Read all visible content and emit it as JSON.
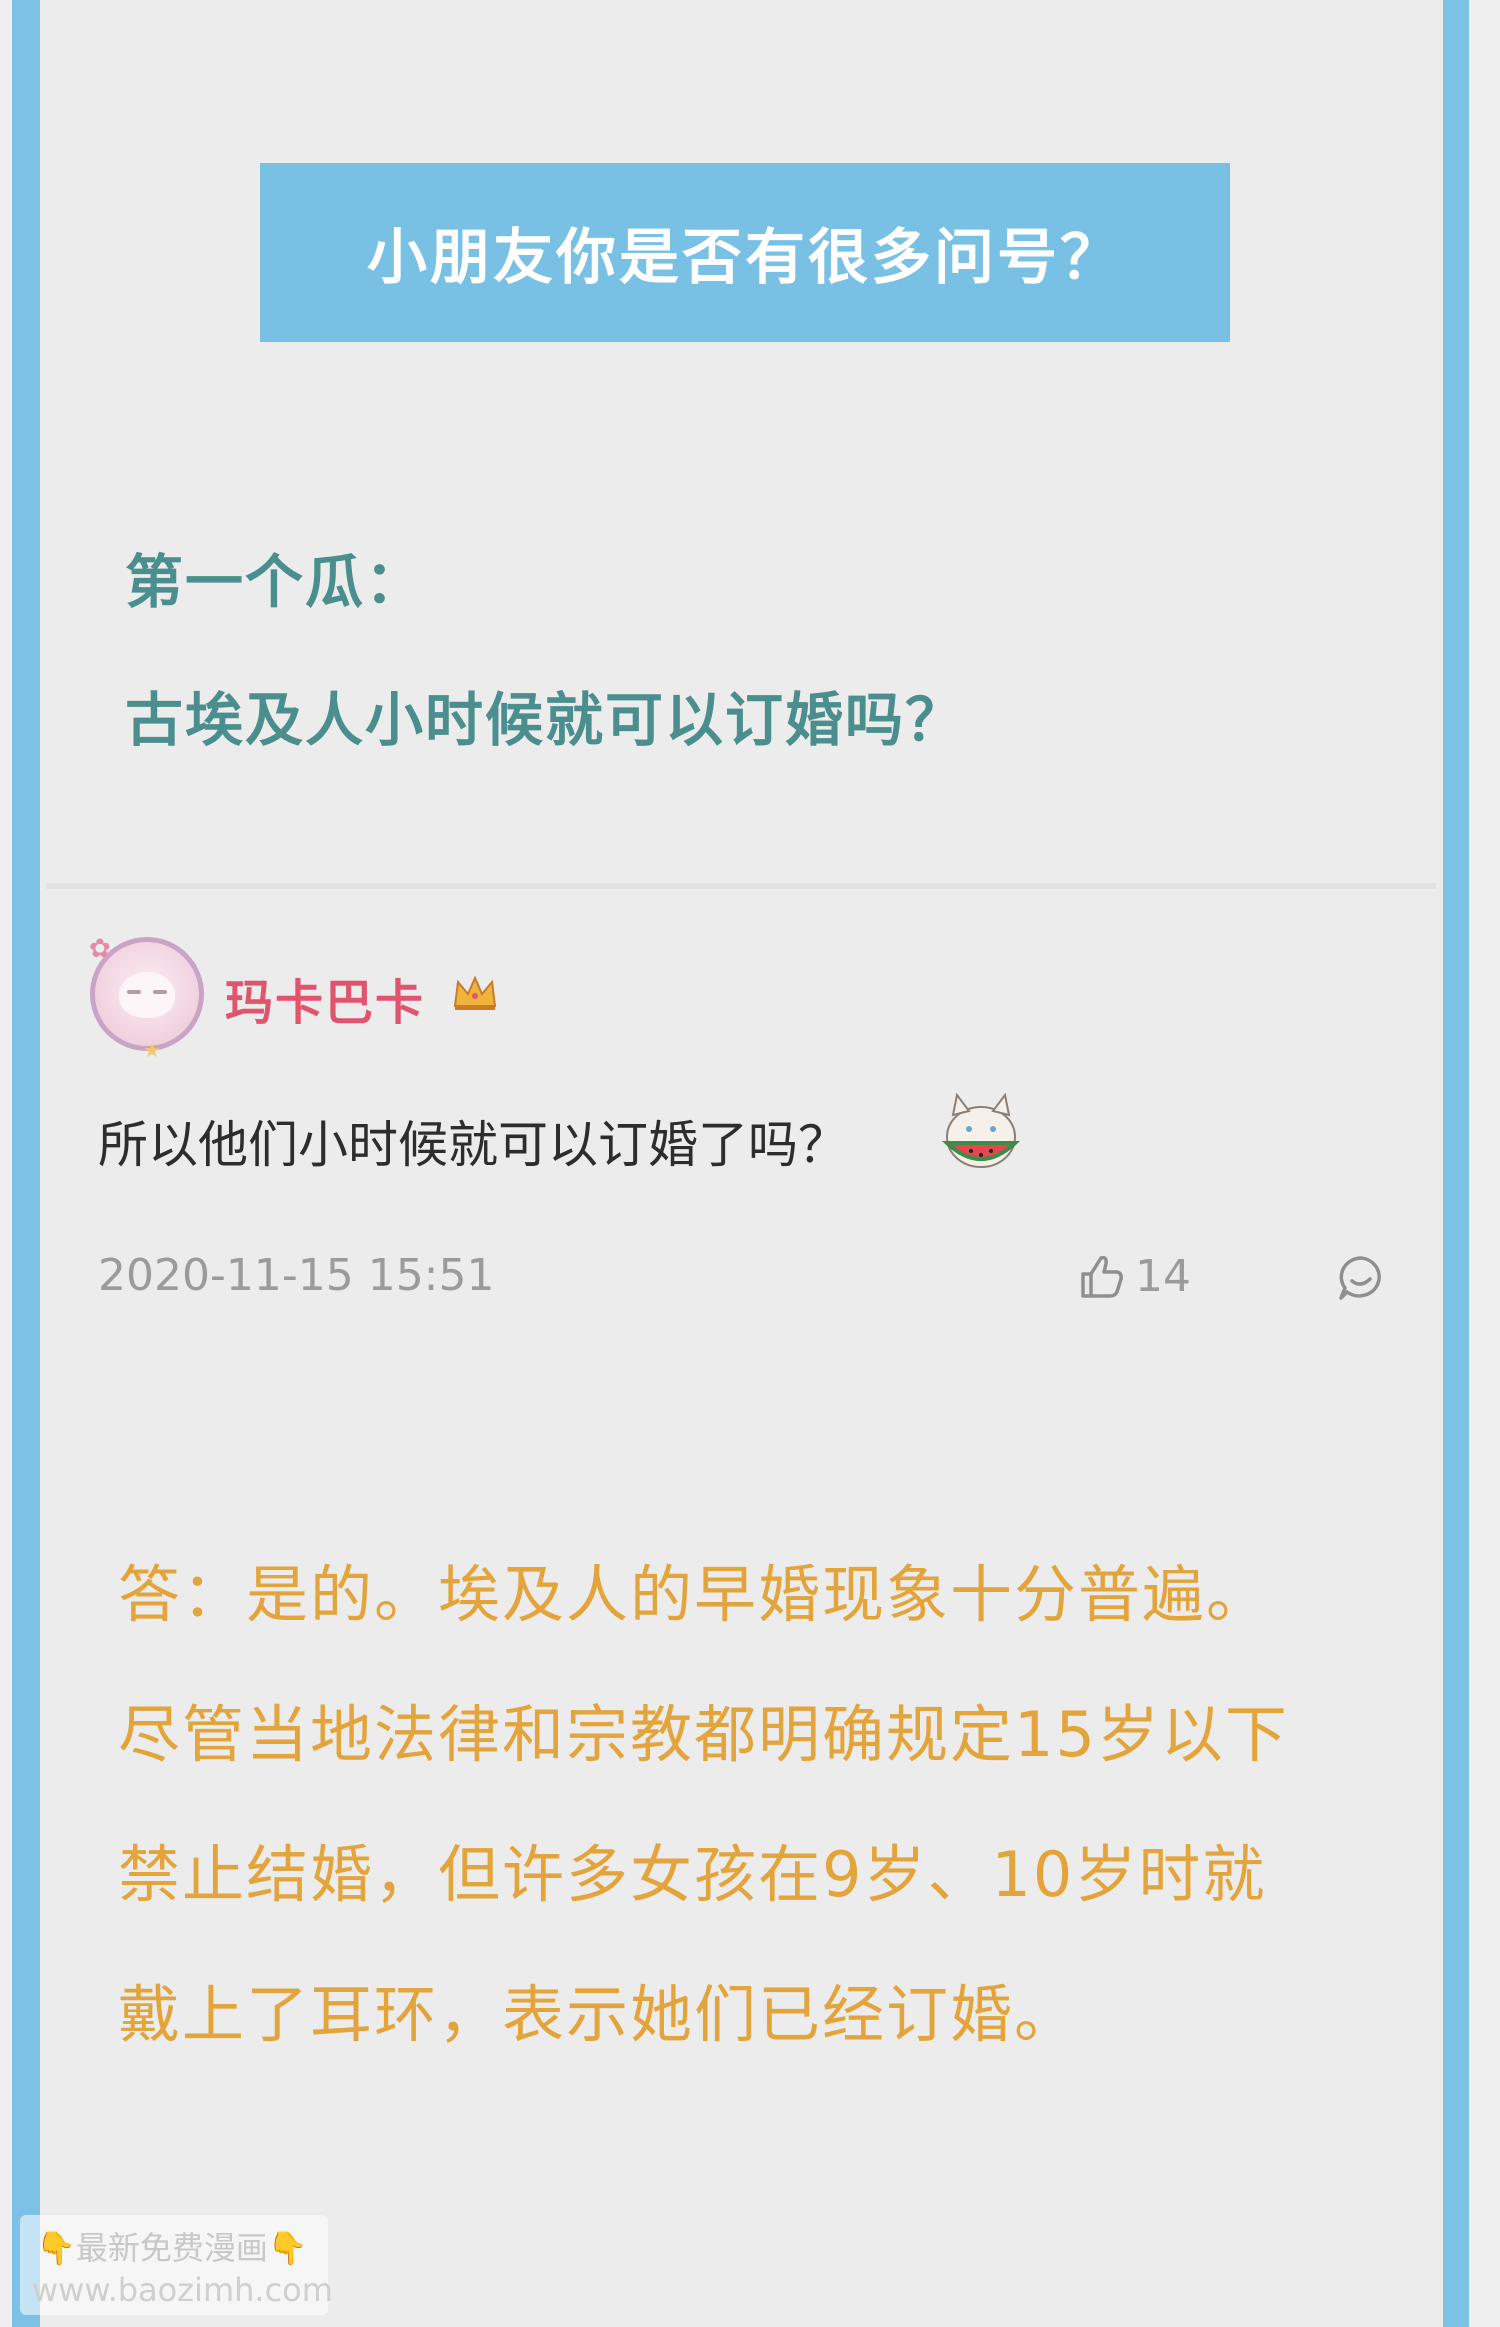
{
  "banner": {
    "title": "小朋友你是否有很多问号？"
  },
  "question": {
    "label": "第一个瓜：",
    "text": "古埃及人小时候就可以订婚吗？"
  },
  "comment": {
    "username": "玛卡巴卡",
    "text": "所以他们小时候就可以订婚了吗？",
    "timestamp": "2020-11-15 15:51",
    "likes": "14",
    "icons": [
      "crown-icon",
      "cat-watermelon-emoji",
      "thumbs-up-icon",
      "reply-icon"
    ]
  },
  "answer": {
    "lines": [
      "答：是的。埃及人的早婚现象十分普遍。",
      "尽管当地法律和宗教都明确规定15岁以下",
      "禁止结婚，但许多女孩在9岁、10岁时就",
      "戴上了耳环，表示她们已经订婚。"
    ]
  },
  "watermark": {
    "line1": "👇最新免费漫画👇",
    "line2": "www.baozimh.com"
  },
  "colors": {
    "frame": "#7cc2e6",
    "banner": "#79c1e4",
    "question": "#4a8f8e",
    "username": "#e0546e",
    "answer": "#e2a43b"
  }
}
